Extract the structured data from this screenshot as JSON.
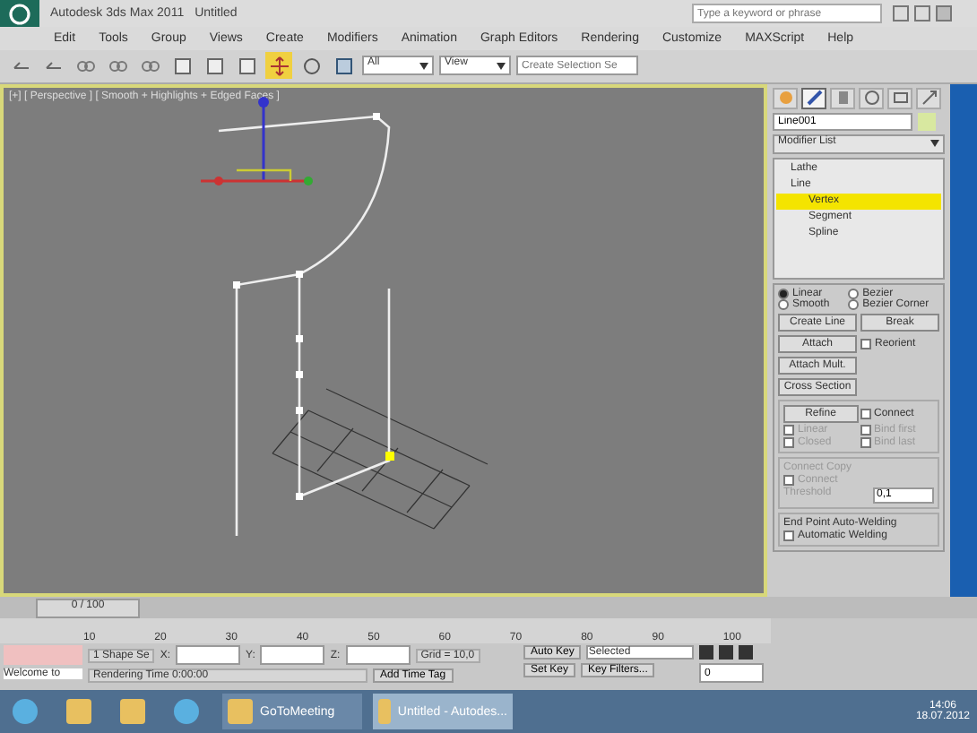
{
  "window": {
    "title": "Autodesk 3ds Max 2011",
    "document": "Untitled",
    "search": {
      "placeholder": "Type a keyword or phrase"
    }
  },
  "menu": [
    "Edit",
    "Tools",
    "Group",
    "Views",
    "Create",
    "Modifiers",
    "Animation",
    "Graph Editors",
    "Rendering",
    "Customize",
    "MAXScript",
    "Help"
  ],
  "toolbar": {
    "tools": [
      {
        "kind": "undo",
        "selected": false
      },
      {
        "kind": "redo",
        "selected": false
      },
      {
        "kind": "link",
        "selected": false
      },
      {
        "kind": "unlink",
        "selected": false
      },
      {
        "kind": "bind",
        "selected": false
      },
      {
        "kind": "select",
        "selected": false
      },
      {
        "kind": "region",
        "selected": false
      },
      {
        "kind": "window",
        "selected": false
      },
      {
        "kind": "move",
        "selected": true
      },
      {
        "kind": "rotate",
        "selected": false
      },
      {
        "kind": "scale",
        "selected": false
      }
    ],
    "filter": "All",
    "coordinate_system": "View",
    "selection_set": {
      "placeholder": "Create Selection Se"
    }
  },
  "viewport": {
    "label": "[+] [ Perspective ] [ Smooth + Highlights + Edged Faces ]"
  },
  "command_panel": {
    "tabs": [
      {
        "kind": "create",
        "selected": false
      },
      {
        "kind": "modify",
        "selected": true
      },
      {
        "kind": "hierarchy",
        "selected": false
      },
      {
        "kind": "motion",
        "selected": false
      },
      {
        "kind": "display",
        "selected": false
      },
      {
        "kind": "utilities",
        "selected": false
      }
    ],
    "object_name": "Line001",
    "modifier_list": "Modifier List",
    "stack": [
      {
        "label": "Lathe",
        "selected": false
      },
      {
        "label": "Line",
        "selected": false,
        "children": [
          {
            "label": "Vertex",
            "selected": true
          },
          {
            "label": "Segment",
            "selected": false
          },
          {
            "label": "Spline",
            "selected": false
          }
        ]
      }
    ],
    "vertex_types": [
      {
        "label": "Linear",
        "selected": true
      },
      {
        "label": "Bezier",
        "selected": false
      },
      {
        "label": "Smooth",
        "selected": false
      },
      {
        "label": "Bezier Corner",
        "selected": false
      }
    ],
    "buttons": [
      "Create Line",
      "Break",
      "Attach",
      "Attach Mult.",
      "Cross Section"
    ],
    "reorient": {
      "label": "Reorient",
      "checked": false
    },
    "refine": {
      "button": "Refine",
      "options": [
        {
          "label": "Connect",
          "checked": false,
          "disabled": false
        },
        {
          "label": "Linear",
          "checked": false,
          "disabled": true
        },
        {
          "label": "Bind first",
          "checked": false,
          "disabled": true
        },
        {
          "label": "Closed",
          "checked": false,
          "disabled": true
        },
        {
          "label": "Bind last",
          "checked": false,
          "disabled": true
        }
      ]
    },
    "connect_copy": {
      "title": "Connect Copy",
      "option": {
        "label": "Connect",
        "checked": false,
        "disabled": true
      },
      "threshold_label": "Threshold",
      "threshold": "0,1"
    },
    "auto_weld": {
      "title": "End Point Auto-Welding",
      "option": {
        "label": "Automatic Welding",
        "checked": false
      }
    }
  },
  "timeline": {
    "frame": "0 / 100",
    "ticks": [
      "10",
      "20",
      "30",
      "40",
      "50",
      "60",
      "70",
      "80",
      "90",
      "100"
    ]
  },
  "status": {
    "welcome": "Welcome to",
    "selection": "1 Shape Se",
    "x_label": "X:",
    "y_label": "Y:",
    "z_label": "Z:",
    "grid": "Grid = 10,0",
    "rendering_time": "Rendering Time 0:00:00",
    "add_time_tag": "Add Time Tag",
    "auto_key": "Auto Key",
    "set_key": "Set Key",
    "key_mode": "Selected",
    "key_filters": "Key Filters...",
    "frame_value": "0"
  },
  "taskbar": {
    "items": [
      {
        "kind": "start",
        "selected": false
      },
      {
        "kind": "folder",
        "selected": false
      },
      {
        "kind": "media",
        "selected": false
      },
      {
        "kind": "browser",
        "selected": false
      },
      {
        "kind": "meeting",
        "label": "GoToMeeting",
        "selected": false
      },
      {
        "kind": "max",
        "label": "Untitled - Autodes...",
        "selected": true
      }
    ],
    "time": "14:06",
    "date": "18.07.2012"
  }
}
